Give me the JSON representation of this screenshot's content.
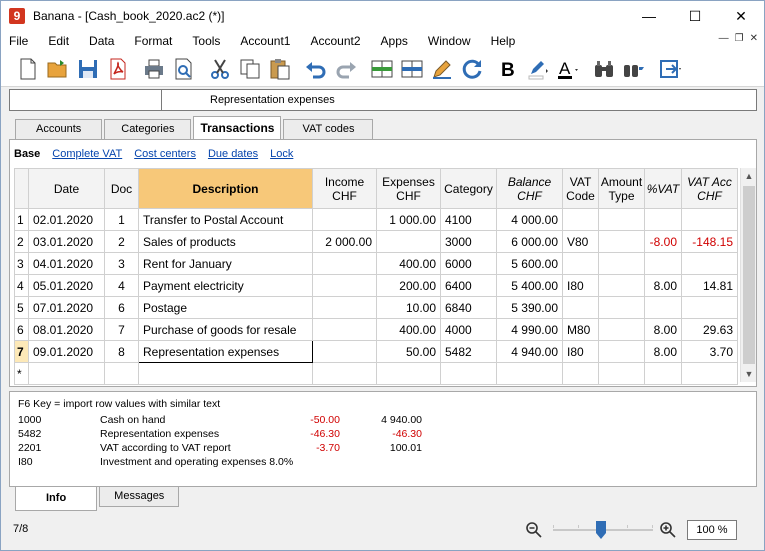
{
  "window": {
    "logo": "9",
    "title": "Banana - [Cash_book_2020.ac2 (*)]",
    "minimize": "—",
    "maximize": "☐",
    "close": "✕"
  },
  "menu": [
    "File",
    "Edit",
    "Data",
    "Format",
    "Tools",
    "Account1",
    "Account2",
    "Apps",
    "Window",
    "Help"
  ],
  "toolbar_icons": [
    "new-file-icon",
    "open-folder-icon",
    "save-icon",
    "pdf-icon",
    "print-icon",
    "print-preview-icon",
    "cut-icon",
    "copy-icon",
    "paste-icon",
    "undo-icon",
    "redo-icon",
    "insert-row-icon",
    "delete-row-icon",
    "edit-pencil-icon",
    "recheck-icon",
    "bold-icon",
    "highlight-icon",
    "font-color-icon",
    "find-icon",
    "replace-icon",
    "cell-format-icon"
  ],
  "cellbar": {
    "left": "",
    "content": "Representation expenses"
  },
  "tabs": [
    "Accounts",
    "Categories",
    "Transactions",
    "VAT codes"
  ],
  "active_tab": "Transactions",
  "views": [
    "Base",
    "Complete VAT",
    "Cost centers",
    "Due dates",
    "Lock"
  ],
  "active_view": "Base",
  "columns": {
    "date": "Date",
    "doc": "Doc",
    "description": "Description",
    "income": [
      "Income",
      "CHF"
    ],
    "expenses": [
      "Expenses",
      "CHF"
    ],
    "category": "Category",
    "balance": [
      "Balance",
      "CHF"
    ],
    "vatcode": [
      "VAT",
      "Code"
    ],
    "amounttype": [
      "Amount",
      "Type"
    ],
    "pctvat": "%VAT",
    "vatacc": [
      "VAT Acc",
      "CHF"
    ]
  },
  "rows": [
    {
      "n": "1",
      "date": "02.01.2020",
      "doc": "1",
      "desc": "Transfer to Postal Account",
      "income": "",
      "expenses": "1 000.00",
      "cat": "4100",
      "balance": "4 000.00",
      "vat": "",
      "atype": "",
      "pct": "",
      "vatacc": ""
    },
    {
      "n": "2",
      "date": "03.01.2020",
      "doc": "2",
      "desc": "Sales of products",
      "income": "2 000.00",
      "expenses": "",
      "cat": "3000",
      "balance": "6 000.00",
      "vat": "V80",
      "atype": "",
      "pct": "-8.00",
      "vatacc": "-148.15"
    },
    {
      "n": "3",
      "date": "04.01.2020",
      "doc": "3",
      "desc": "Rent for January",
      "income": "",
      "expenses": "400.00",
      "cat": "6000",
      "balance": "5 600.00",
      "vat": "",
      "atype": "",
      "pct": "",
      "vatacc": ""
    },
    {
      "n": "4",
      "date": "05.01.2020",
      "doc": "4",
      "desc": "Payment electricity",
      "income": "",
      "expenses": "200.00",
      "cat": "6400",
      "balance": "5 400.00",
      "vat": "I80",
      "atype": "",
      "pct": "8.00",
      "vatacc": "14.81"
    },
    {
      "n": "5",
      "date": "07.01.2020",
      "doc": "6",
      "desc": "Postage",
      "income": "",
      "expenses": "10.00",
      "cat": "6840",
      "balance": "5 390.00",
      "vat": "",
      "atype": "",
      "pct": "",
      "vatacc": ""
    },
    {
      "n": "6",
      "date": "08.01.2020",
      "doc": "7",
      "desc": "Purchase of goods for resale",
      "income": "",
      "expenses": "400.00",
      "cat": "4000",
      "balance": "4 990.00",
      "vat": "M80",
      "atype": "",
      "pct": "8.00",
      "vatacc": "29.63"
    },
    {
      "n": "7",
      "date": "09.01.2020",
      "doc": "8",
      "desc": "Representation expenses",
      "income": "",
      "expenses": "50.00",
      "cat": "5482",
      "balance": "4 940.00",
      "vat": "I80",
      "atype": "",
      "pct": "8.00",
      "vatacc": "3.70"
    },
    {
      "n": "*",
      "date": "",
      "doc": "",
      "desc": "",
      "income": "",
      "expenses": "",
      "cat": "",
      "balance": "",
      "vat": "",
      "atype": "",
      "pct": "",
      "vatacc": ""
    }
  ],
  "current_row": "7",
  "info": {
    "hint": "F6 Key = import row values with similar text",
    "lines": [
      {
        "acc": "1000",
        "name": "Cash on hand",
        "amount": "-50.00",
        "total": "4 940.00",
        "total_red": false
      },
      {
        "acc": "5482",
        "name": "Representation expenses",
        "amount": "-46.30",
        "total": "-46.30",
        "total_red": true
      },
      {
        "acc": "2201",
        "name": "VAT according to VAT report",
        "amount": "-3.70",
        "total": "100.01",
        "total_red": false
      },
      {
        "acc": "I80",
        "name": "Investment and operating expenses 8.0%",
        "amount": "",
        "total": "",
        "total_red": false
      }
    ]
  },
  "bottom_tabs": [
    "Info",
    "Messages"
  ],
  "status": {
    "rowcount": "7/8",
    "zoom": "100 %"
  },
  "colors": {
    "header_bg": "#f3f3f3",
    "description_header": "#f7c879",
    "negative": "#d00000",
    "link": "#0645ad",
    "logo": "#d2361f"
  }
}
